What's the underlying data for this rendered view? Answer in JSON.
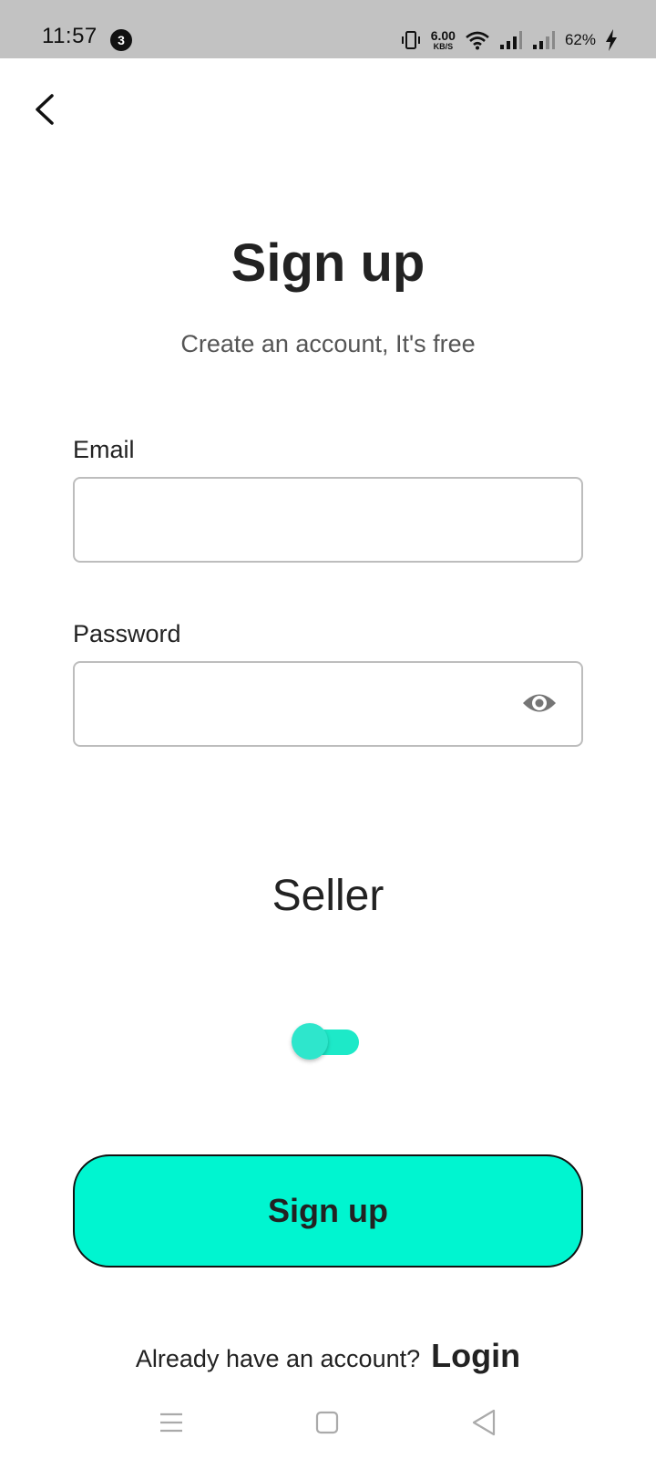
{
  "status_bar": {
    "time": "11:57",
    "notification_count": "3",
    "speed_value": "6.00",
    "speed_unit": "KB/S",
    "battery": "62%"
  },
  "header": {
    "title": "Sign up",
    "subtitle": "Create an account, It's free"
  },
  "form": {
    "email_label": "Email",
    "email_value": "",
    "password_label": "Password",
    "password_value": ""
  },
  "seller": {
    "label": "Seller",
    "enabled": false
  },
  "actions": {
    "signup_label": "Sign up",
    "login_prompt": "Already have an account?",
    "login_label": "Login"
  },
  "colors": {
    "accent": "#00f5d0",
    "toggle": "#1de9c8",
    "status_bar_bg": "#c2c2c2"
  },
  "icons": {
    "back": "arrow-back-icon",
    "password_visibility": "eye-icon",
    "nav_menu": "menu-icon",
    "nav_home": "home-icon",
    "nav_back": "back-triangle-icon"
  }
}
